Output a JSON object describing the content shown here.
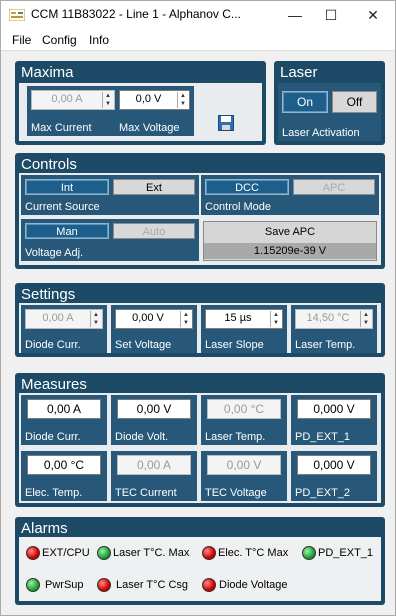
{
  "window": {
    "title": "CCM 11B83022 - Line 1 - Alphanov C...",
    "minimize": "—",
    "maximize": "☐",
    "close": "✕"
  },
  "menu": {
    "file": "File",
    "config": "Config",
    "info": "Info"
  },
  "maxima": {
    "title": "Maxima",
    "max_current_value": "0,00 A",
    "max_current_label": "Max Current",
    "max_voltage_value": "0,0 V",
    "max_voltage_label": "Max Voltage"
  },
  "laser": {
    "title": "Laser",
    "on_label": "On",
    "off_label": "Off",
    "activation_label": "Laser Activation"
  },
  "controls": {
    "title": "Controls",
    "int_label": "Int",
    "ext_label": "Ext",
    "current_source_label": "Current Source",
    "dcc_label": "DCC",
    "apc_label": "APC",
    "control_mode_label": "Control Mode",
    "man_label": "Man",
    "auto_label": "Auto",
    "voltage_adj_label": "Voltage Adj.",
    "save_apc_label": "Save APC",
    "save_apc_value": "1.15209e-39 V"
  },
  "settings": {
    "title": "Settings",
    "diode_curr_value": "0,00 A",
    "diode_curr_label": "Diode Curr.",
    "set_voltage_value": "0,00 V",
    "set_voltage_label": "Set Voltage",
    "laser_slope_value": "15 µs",
    "laser_slope_label": "Laser Slope",
    "laser_temp_value": "14,50 °C",
    "laser_temp_label": "Laser Temp."
  },
  "measures": {
    "title": "Measures",
    "diode_curr_value": "0,00 A",
    "diode_curr_label": "Diode Curr.",
    "diode_volt_value": "0,00 V",
    "diode_volt_label": "Diode Volt.",
    "laser_temp_value": "0,00 °C",
    "laser_temp_label": "Laser Temp.",
    "pd_ext_1_value": "0,000 V",
    "pd_ext_1_label": "PD_EXT_1",
    "elec_temp_value": "0,00 °C",
    "elec_temp_label": "Elec. Temp.",
    "tec_current_value": "0,00 A",
    "tec_current_label": "TEC Current",
    "tec_voltage_value": "0,00 V",
    "tec_voltage_label": "TEC Voltage",
    "pd_ext_2_value": "0,000 V",
    "pd_ext_2_label": "PD_EXT_2"
  },
  "alarms": {
    "title": "Alarms",
    "items": [
      {
        "label": "EXT/CPU",
        "state": "red"
      },
      {
        "label": "Laser T°C. Max",
        "state": "green"
      },
      {
        "label": "Elec. T°C Max",
        "state": "red"
      },
      {
        "label": "PD_EXT_1",
        "state": "green"
      },
      {
        "label": "PwrSup",
        "state": "green"
      },
      {
        "label": "Laser T°C Csg",
        "state": "red"
      },
      {
        "label": "Diode Voltage",
        "state": "red"
      }
    ]
  },
  "colors": {
    "group_header": "#1d4a66",
    "cell_bg": "#275879",
    "toggle_on": "#1d5f8a",
    "led_red": "#d20000",
    "led_green": "#1e9e3a"
  }
}
